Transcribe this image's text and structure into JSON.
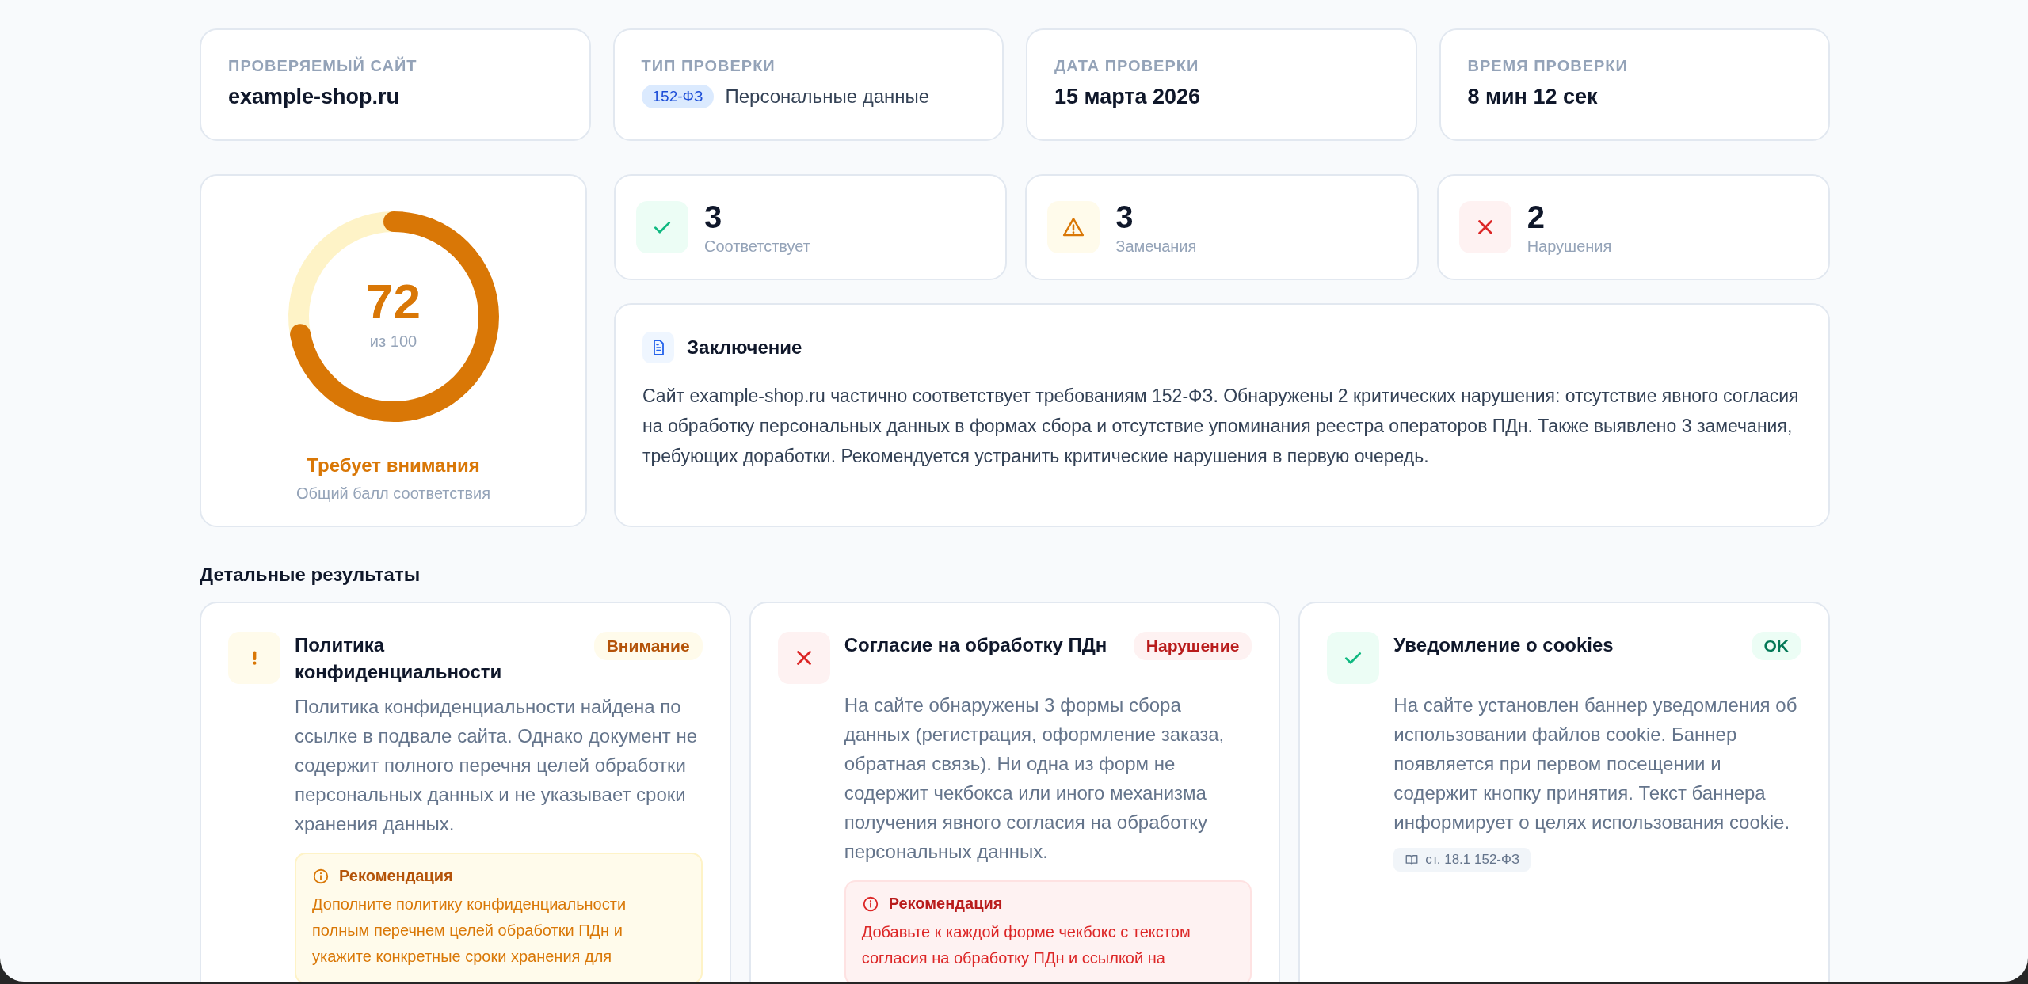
{
  "summary": [
    {
      "label": "ПРОВЕРЯЕМЫЙ САЙТ",
      "value": "example-shop.ru"
    },
    {
      "label": "ТИП ПРОВЕРКИ",
      "tag": "152-ФЗ",
      "value": "Персональные данные"
    },
    {
      "label": "ДАТА ПРОВЕРКИ",
      "value": "15 марта 2026"
    },
    {
      "label": "ВРЕМЯ ПРОВЕРКИ",
      "value": "8 мин 12 сек"
    }
  ],
  "score": {
    "value": "72",
    "of": "из 100",
    "level": 0.72,
    "verdict": "Требует внимания",
    "caption": "Общий балл соответствия"
  },
  "stats": [
    {
      "kind": "ok",
      "count": "3",
      "label": "Соответствует"
    },
    {
      "kind": "warning",
      "count": "3",
      "label": "Замечания"
    },
    {
      "kind": "violation",
      "count": "2",
      "label": "Нарушения"
    }
  ],
  "conclusion": {
    "title": "Заключение",
    "text": "Сайт example-shop.ru частично соответствует требованиям 152-ФЗ. Обнаружены 2 критических нарушения: отсутствие явного согласия на обработку персональных данных в формах сбора и отсутствие упоминания реестра операторов ПДн. Также выявлено 3 замечания, требующих доработки. Рекомендуется устранить критические нарушения в первую очередь."
  },
  "details": {
    "heading": "Детальные результаты",
    "items": [
      {
        "kind": "warning",
        "title": "Политика конфиденциальности",
        "badge": "Внимание",
        "text": "Политика конфиденциальности найдена по ссылке в подвале сайта. Однако документ не содержит полного перечня целей обработки персональных данных и не указывает сроки хранения данных.",
        "recommendation": {
          "title": "Рекомендация",
          "text": "Дополните политику конфиденциальности полным перечнем целей обработки ПДн и укажите конкретные сроки хранения для"
        }
      },
      {
        "kind": "violation",
        "title": "Согласие на обработку ПДн",
        "badge": "Нарушение",
        "text": "На сайте обнаружены 3 формы сбора данных (регистрация, оформление заказа, обратная связь). Ни одна из форм не содержит чекбокса или иного механизма получения явного согласия на обработку персональных данных.",
        "recommendation": {
          "title": "Рекомендация",
          "text": "Добавьте к каждой форме чекбокс с текстом согласия на обработку ПДн и ссылкой на"
        }
      },
      {
        "kind": "ok",
        "title": "Уведомление о cookies",
        "badge": "OK",
        "text": "На сайте установлен баннер уведомления об использовании файлов cookie. Баннер появляется при первом посещении и содержит кнопку принятия. Текст баннера информирует о целях использования cookie.",
        "reference": "ст. 18.1 152-ФЗ"
      }
    ]
  }
}
